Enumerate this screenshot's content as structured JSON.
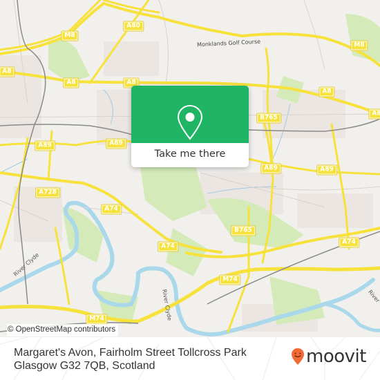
{
  "map": {
    "attribution": "© OpenStreetMap contributors",
    "road_labels": [
      {
        "id": "m8-west",
        "text": "M8"
      },
      {
        "id": "a80",
        "text": "A80"
      },
      {
        "id": "m8-east",
        "text": "M8"
      },
      {
        "id": "a8-far-west",
        "text": "A8"
      },
      {
        "id": "a8-west",
        "text": "A8"
      },
      {
        "id": "a8-center",
        "text": "A8"
      },
      {
        "id": "a8-east",
        "text": "A8"
      },
      {
        "id": "a8-far-east",
        "text": "A8"
      },
      {
        "id": "b765-north",
        "text": "B765"
      },
      {
        "id": "a89-west",
        "text": "A89"
      },
      {
        "id": "a89-center",
        "text": "A89"
      },
      {
        "id": "a89-east",
        "text": "A89"
      },
      {
        "id": "a89-far-east",
        "text": "A89"
      },
      {
        "id": "a728",
        "text": "A728"
      },
      {
        "id": "a74-west",
        "text": "A74"
      },
      {
        "id": "a74-center",
        "text": "A74"
      },
      {
        "id": "b765-south",
        "text": "B765"
      },
      {
        "id": "a74-east",
        "text": "A74"
      },
      {
        "id": "m74-east",
        "text": "M74"
      },
      {
        "id": "m74-west",
        "text": "M74"
      }
    ],
    "feature_labels": {
      "golf_course": "Monklands Golf Course",
      "river_clyde_west": "River Clyde",
      "river_clyde_center": "River Clyde",
      "river_clyde_east": "River"
    },
    "colors": {
      "land": "#f2f0ed",
      "park": "#cfe8b0",
      "road": "#f7e23b",
      "water": "#a9d8ea",
      "rail": "#777777"
    }
  },
  "popup": {
    "button_label": "Take me there",
    "icon": "map-pin-icon",
    "color": "#1fb565"
  },
  "footer": {
    "address_line1": "Margaret's Avon, Fairholm Street Tollcross Park",
    "address_line2": "Glasgow G32 7QB, Scotland",
    "brand": "moovit",
    "brand_color": "#f26a36"
  }
}
